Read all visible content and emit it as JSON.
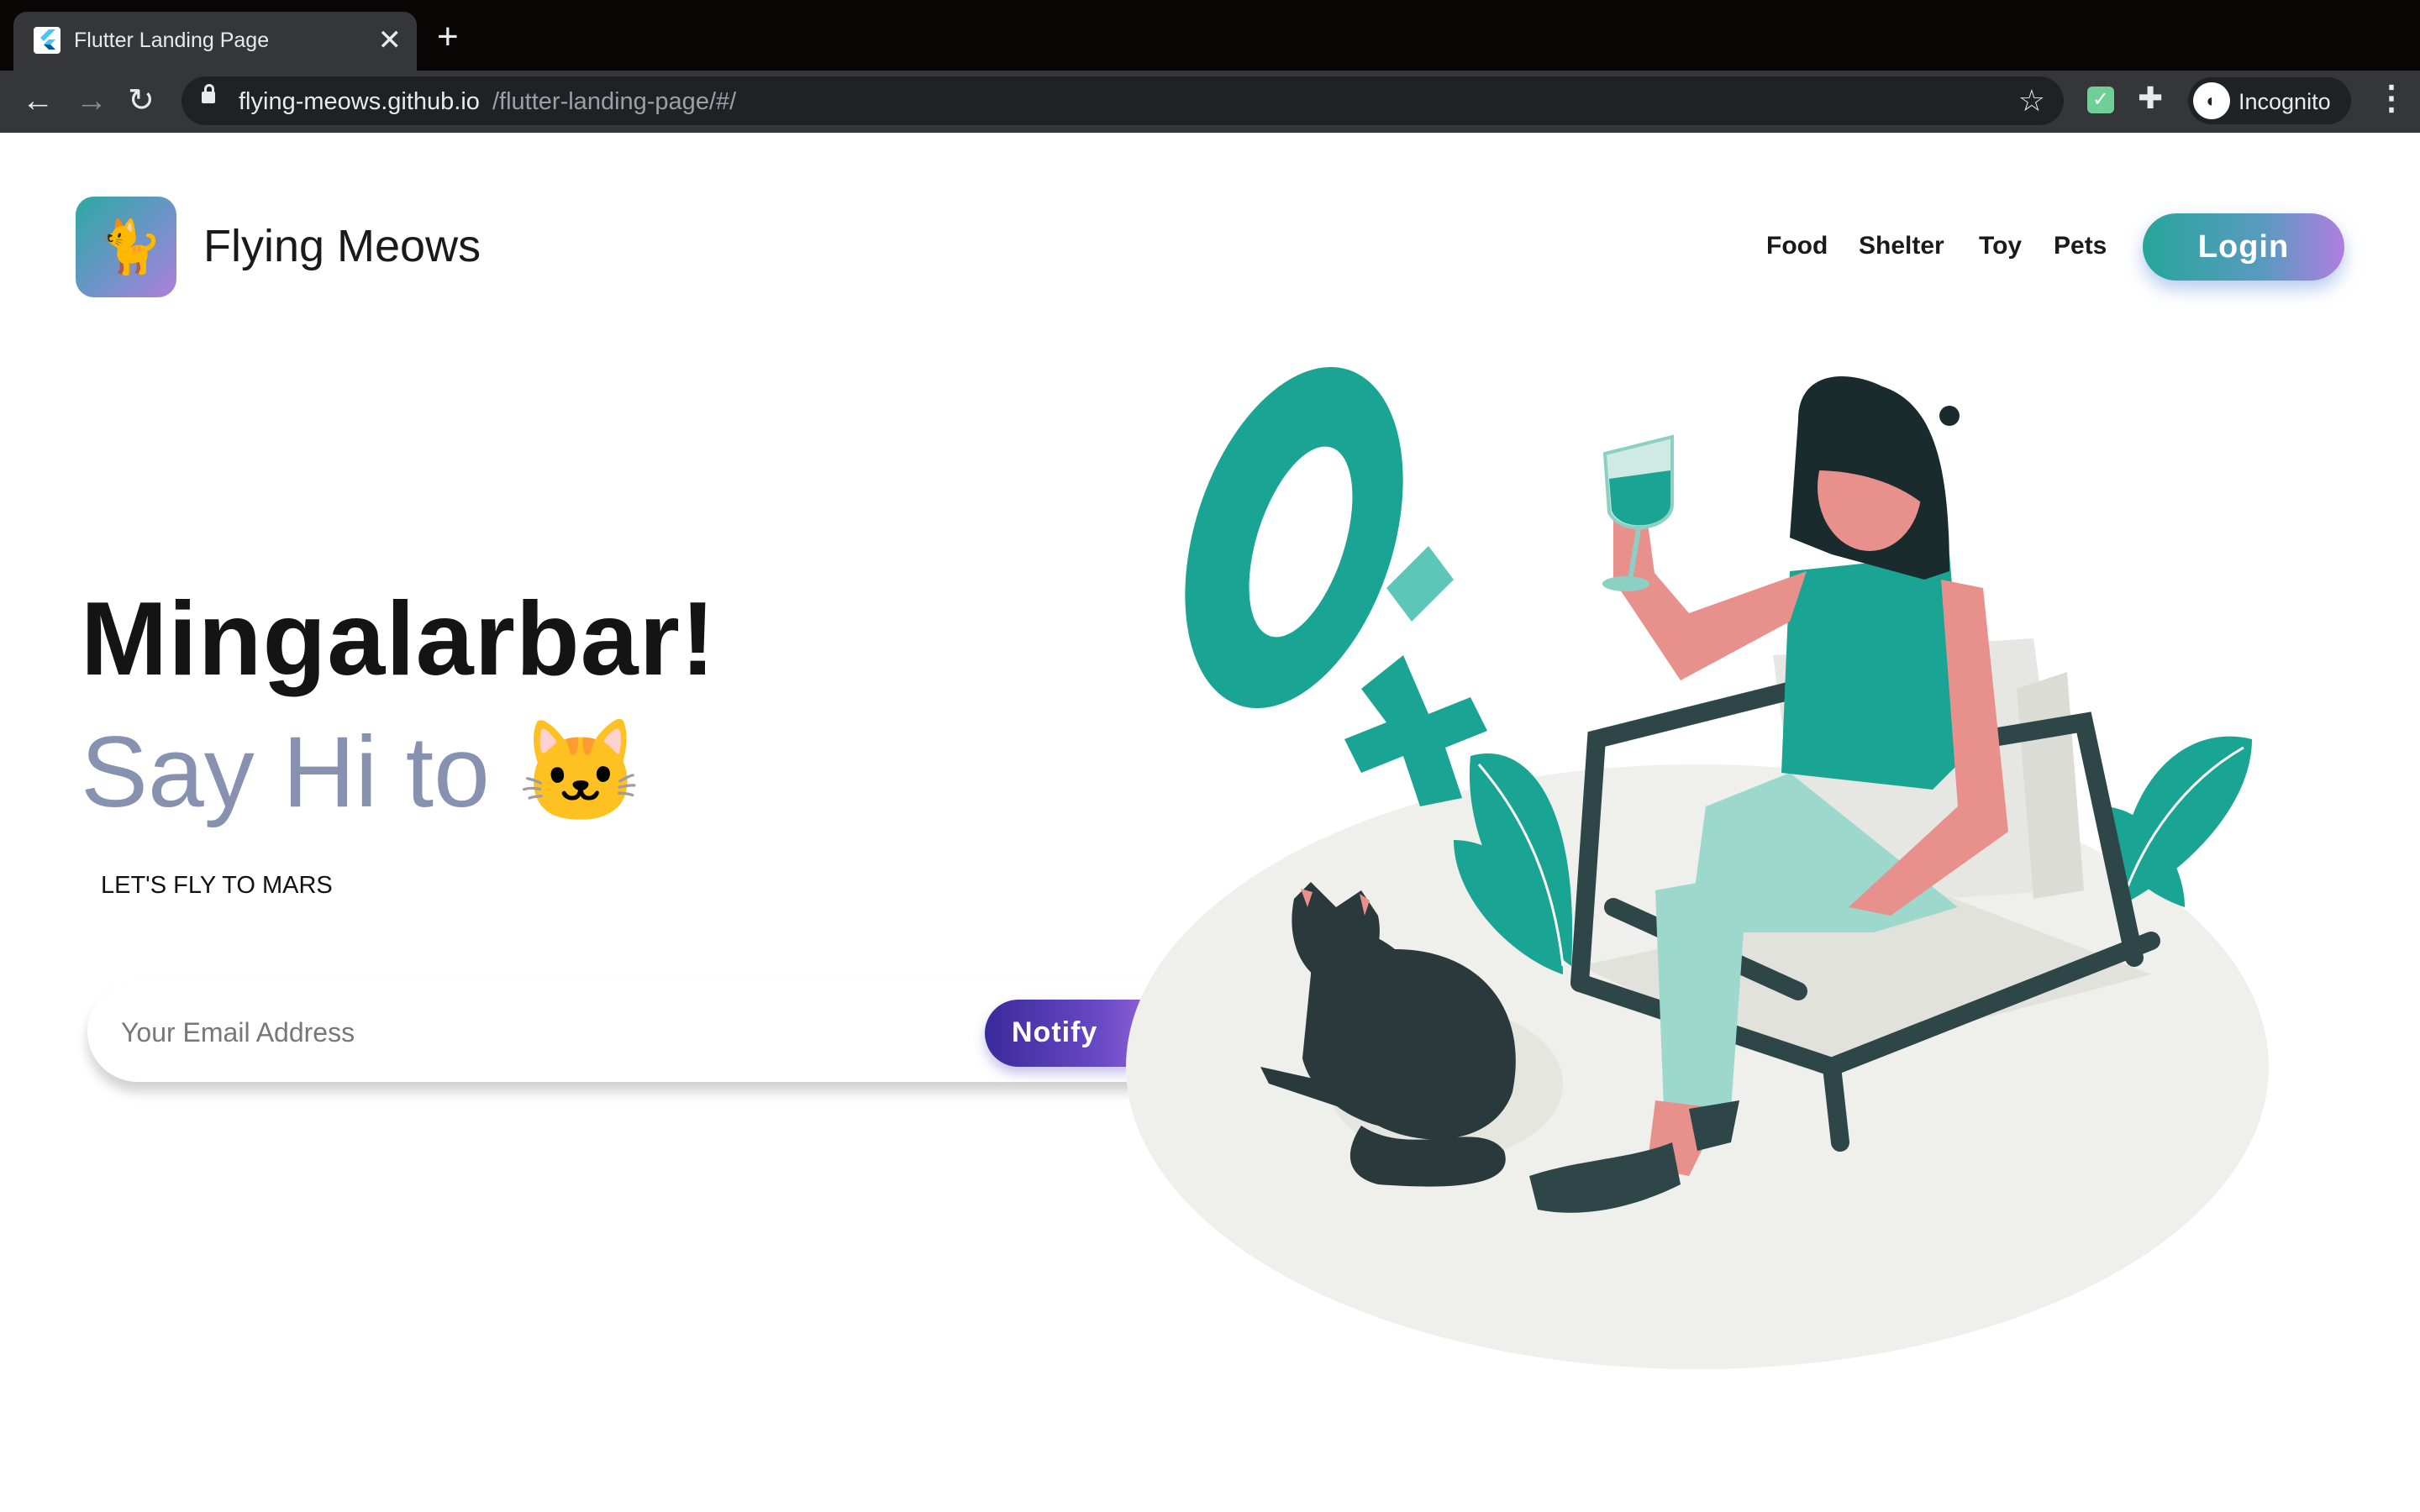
{
  "browser": {
    "tab_title": "Flutter Landing Page",
    "url_host": "flying-meows.github.io",
    "url_path": "/flutter-landing-page/#/",
    "profile_label": "Incognito"
  },
  "header": {
    "brand": "Flying Meows",
    "nav": [
      "Food",
      "Shelter",
      "Toy",
      "Pets"
    ],
    "login_label": "Login"
  },
  "hero": {
    "headline": "Mingalarbar!",
    "subheadline": "Say Hi to 🐱",
    "tagline": "LET'S FLY TO MARS",
    "email_placeholder": "Your Email Address",
    "notify_label": "Notify"
  },
  "icons": {
    "logo": "cat-icon",
    "notify": "paper-plane-icon"
  },
  "colors": {
    "teal": "#1aa493",
    "headline": "#141414",
    "subheadline": "#8791b0",
    "notify_gradient": [
      "#3a2a9a",
      "#c080e0"
    ],
    "login_gradient": [
      "#26a69a",
      "#b07ee0"
    ]
  }
}
